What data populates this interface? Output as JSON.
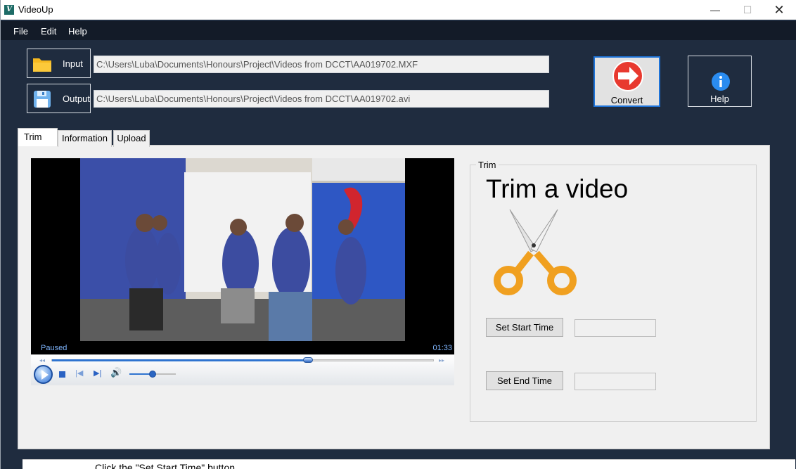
{
  "window": {
    "title": "VideoUp",
    "icon": "videoup-app-icon",
    "controls": {
      "minimize": "—",
      "maximize": "☐",
      "close": "✕"
    }
  },
  "menu": {
    "file": "File",
    "edit": "Edit",
    "help": "Help"
  },
  "io": {
    "input_label": "Input",
    "input_icon": "folder-icon",
    "input_path": "C:\\Users\\Luba\\Documents\\Honours\\Project\\Videos from DCCT\\AA019702.MXF",
    "output_label": "Output",
    "output_icon": "save-disk-icon",
    "output_path": "C:\\Users\\Luba\\Documents\\Honours\\Project\\Videos from DCCT\\AA019702.avi"
  },
  "actions": {
    "convert_label": "Convert",
    "convert_icon": "red-arrow-icon",
    "help_label": "Help",
    "help_icon": "info-icon"
  },
  "tabs": [
    {
      "label": "Trim",
      "selected": true
    },
    {
      "label": "Information",
      "selected": false
    },
    {
      "label": "Upload",
      "selected": false
    }
  ],
  "player": {
    "status": "Paused",
    "time": "01:33",
    "seek_fraction": 0.67,
    "volume_fraction": 0.5,
    "rewind_glyph": "◂◂",
    "forward_glyph": "▸▸",
    "prev_glyph": "|◀",
    "next_glyph": "▶|",
    "volume_glyph": "🔊"
  },
  "trim": {
    "group_label": "Trim",
    "heading": "Trim a video",
    "icon": "scissors-icon",
    "start_button": "Set Start Time",
    "start_value": "",
    "end_button": "Set End Time",
    "end_value": ""
  },
  "background_text": "Click the \"Set Start Time\" button",
  "colors": {
    "window_bg": "#1f2c3f",
    "menu_bg": "#131b28",
    "accent_blue": "#1e73d8",
    "convert_red": "#e8392f",
    "help_blue": "#2a8cf0",
    "scissors_orange": "#f0a020"
  }
}
